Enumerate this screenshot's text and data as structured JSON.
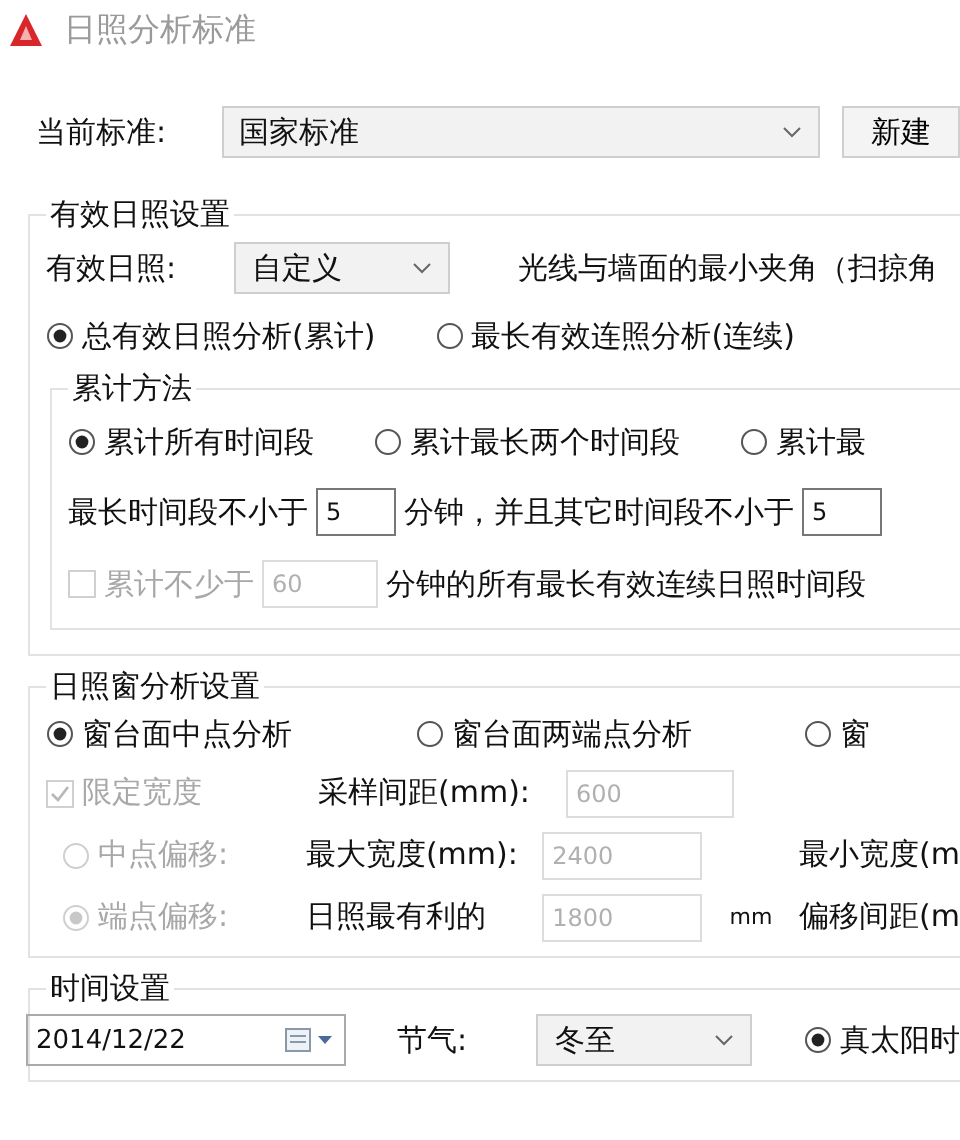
{
  "window": {
    "title": "日照分析标准"
  },
  "standard": {
    "label": "当前标准:",
    "value": "国家标准",
    "button": "新建"
  },
  "effective_group": {
    "title": "有效日照设置",
    "effective": {
      "label": "有效日照:",
      "value": "自定义"
    },
    "angle_label": "光线与墙面的最小夹角（扫掠角",
    "modes": [
      {
        "label": "总有效日照分析(累计)",
        "selected": true
      },
      {
        "label": "最长有效连照分析(连续)",
        "selected": false
      }
    ],
    "method": {
      "title": "累计方法",
      "options": [
        {
          "label": "累计所有时间段",
          "selected": true
        },
        {
          "label": "累计最长两个时间段",
          "selected": false
        },
        {
          "label": "累计最",
          "selected": false
        }
      ],
      "min_row": {
        "text_1": "最长时间段不小于",
        "input_1": "5",
        "text_2": "分钟，并且其它时间段不小于",
        "input_2": "5"
      },
      "total": {
        "label": "累计不少于",
        "checked": false,
        "disabled": true,
        "value": "60",
        "suffix": "分钟的所有最长有效连续日照时间段"
      }
    }
  },
  "window_group": {
    "title": "日照窗分析设置",
    "modes": [
      {
        "label": "窗台面中点分析",
        "selected": true
      },
      {
        "label": "窗台面两端点分析",
        "selected": false
      },
      {
        "label": "窗",
        "selected": false
      }
    ],
    "limit_width": {
      "label": "限定宽度",
      "checked": true,
      "disabled": true
    },
    "sample": {
      "label": "采样间距(mm):",
      "value": "600"
    },
    "offsets": [
      {
        "label": "中点偏移:",
        "selected": false,
        "disabled": true,
        "field_label": "最大宽度(mm):",
        "value": "2400",
        "right_label": "最小宽度(m"
      },
      {
        "label": "端点偏移:",
        "selected": true,
        "disabled": true,
        "field_label": "日照最有利的",
        "value": "1800",
        "unit": "mm",
        "right_label": "偏移间距(m"
      }
    ]
  },
  "time_group": {
    "title": "时间设置",
    "date": "2014/12/22",
    "term": {
      "label": "节气:",
      "value": "冬至"
    },
    "solar": {
      "label": "真太阳时",
      "selected": true
    }
  }
}
